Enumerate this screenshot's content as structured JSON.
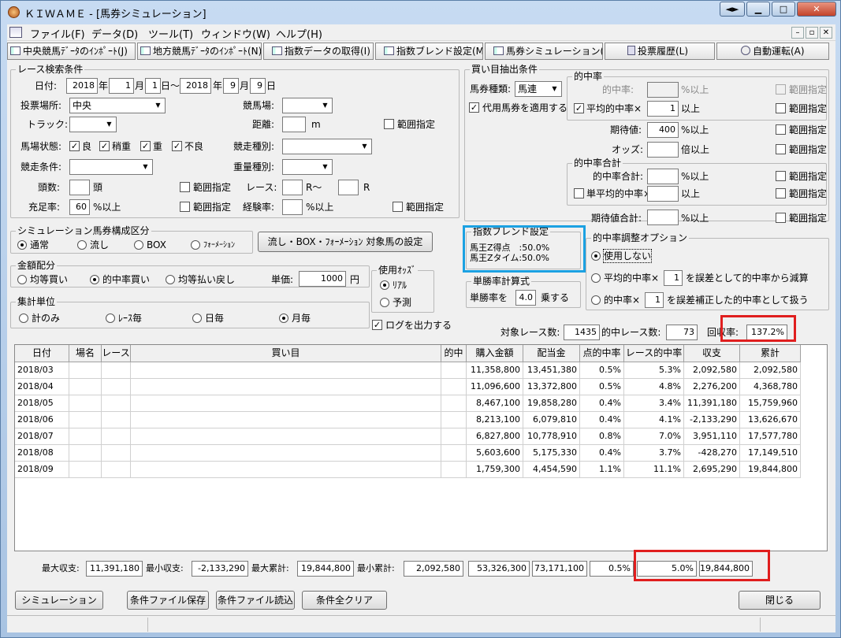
{
  "window": {
    "title": "ＫＩＷＡＭＥ - [馬券シミュレーション]"
  },
  "menu": [
    "ファイル(F)",
    "データ(D)",
    "ツール(T)",
    "ウィンドウ(W)",
    "ヘルプ(H)"
  ],
  "toolbar": [
    "中央競馬ﾃﾞｰﾀのｲﾝﾎﾟｰﾄ(J)",
    "地方競馬ﾃﾞｰﾀのｲﾝﾎﾟｰﾄ(N)",
    "指数データの取得(I)",
    "指数ブレンド設定(M)",
    "馬券シミュレーション(B)",
    "投票履歴(L)",
    "自動運転(A)"
  ],
  "race_search": {
    "label": "レース検索条件",
    "date_label": "日付:",
    "from_year": "2018",
    "from_month": "1",
    "from_day": "1",
    "to_year": "2018",
    "to_month": "9",
    "to_day": "9",
    "u_year": "年",
    "u_month": "月",
    "u_day_from": "日～",
    "u_day": "日",
    "venue_label": "投票場所:",
    "venue": "中央",
    "track_label": "競馬場:",
    "track2_label": "トラック:",
    "distance_label": "距離:",
    "distance_unit": "m",
    "range": "範囲指定",
    "condition_label": "馬場状態:",
    "conditions": [
      "良",
      "稍重",
      "重",
      "不良"
    ],
    "race_type_label": "競走種別:",
    "race_cond_label": "競走条件:",
    "weight_label": "重量種別:",
    "heads_label": "頭数:",
    "heads_unit": "頭",
    "race_label": "レース:",
    "r_from": "R～",
    "r_to": "R",
    "fill_label": "充足率:",
    "fill_value": "60",
    "fill_unit": "%以上",
    "exp_label": "経験率:",
    "exp_unit": "%以上"
  },
  "ticket_comp": {
    "label": "シミュレーション馬券構成区分",
    "options": [
      "通常",
      "流し",
      "BOX",
      "ﾌｫｰﾒｰｼｮﾝ"
    ],
    "selected": 0,
    "button": "流し・BOX・ﾌｫｰﾒｰｼｮﾝ 対象馬の設定"
  },
  "amount": {
    "label": "金額配分",
    "options": [
      "均等買い",
      "的中率買い",
      "均等払い戻し"
    ],
    "selected": 1,
    "unit_label": "単価:",
    "unit_value": "1000",
    "yen": "円"
  },
  "odds": {
    "label": "使用ｵｯｽﾞ",
    "options": [
      "ﾘｱﾙ",
      "予測"
    ],
    "selected": 0
  },
  "aggregate": {
    "label": "集計単位",
    "options": [
      "計のみ",
      "ﾚｰｽ毎",
      "日毎",
      "月毎"
    ],
    "selected": 3
  },
  "log_output": "ログを出力する",
  "extract": {
    "label": "買い目抽出条件",
    "type_label": "馬券種類:",
    "type_value": "馬連",
    "substitute": "代用馬券を適用する",
    "hit_group": "的中率",
    "hit_rate": "的中率:",
    "pct_over": "%以上",
    "avg_hit": "平均的中率×",
    "avg_value": "1",
    "over": "以上",
    "expect_label": "期待値:",
    "expect_value": "400",
    "odds_label": "オッズ:",
    "odds_unit": "倍以上",
    "sum_group": "的中率合計",
    "hit_sum": "的中率合計:",
    "single_avg": "単平均的中率×",
    "expect_sum": "期待値合計:",
    "range": "範囲指定"
  },
  "blend": {
    "label": "指数ブレンド設定",
    "line1": "馬王Z得点　:50.0%",
    "line2": "馬王Zタイム:50.0%"
  },
  "win_rate": {
    "label": "単勝率計算式",
    "prefix": "単勝率を",
    "value": "4.0",
    "suffix": "乗する"
  },
  "adjust": {
    "label": "的中率調整オプション",
    "opt0": "使用しない",
    "opt1a": "平均的中率×",
    "opt1b": "を誤差として的中率から減算",
    "opt2a": "的中率×",
    "opt2b": "を誤差補正した的中率として扱う",
    "v1": "1",
    "v2": "1",
    "selected": 0
  },
  "summary": {
    "target_label": "対象レース数:",
    "target": "1435",
    "hit_label": "的中レース数:",
    "hit": "73",
    "recovery_label": "回収率:",
    "recovery": "137.2%"
  },
  "table": {
    "headers": [
      "日付",
      "場名",
      "レース",
      "買い目",
      "的中",
      "購入金額",
      "配当金",
      "点的中率",
      "レース的中率",
      "収支",
      "累計"
    ],
    "rows": [
      [
        "2018/03",
        "",
        "",
        "",
        "",
        "11,358,800",
        "13,451,380",
        "0.5%",
        "5.3%",
        "2,092,580",
        "2,092,580"
      ],
      [
        "2018/04",
        "",
        "",
        "",
        "",
        "11,096,600",
        "13,372,800",
        "0.5%",
        "4.8%",
        "2,276,200",
        "4,368,780"
      ],
      [
        "2018/05",
        "",
        "",
        "",
        "",
        "8,467,100",
        "19,858,280",
        "0.4%",
        "3.4%",
        "11,391,180",
        "15,759,960"
      ],
      [
        "2018/06",
        "",
        "",
        "",
        "",
        "8,213,100",
        "6,079,810",
        "0.4%",
        "4.1%",
        "-2,133,290",
        "13,626,670"
      ],
      [
        "2018/07",
        "",
        "",
        "",
        "",
        "6,827,800",
        "10,778,910",
        "0.8%",
        "7.0%",
        "3,951,110",
        "17,577,780"
      ],
      [
        "2018/08",
        "",
        "",
        "",
        "",
        "5,603,600",
        "5,175,330",
        "0.4%",
        "3.7%",
        "-428,270",
        "17,149,510"
      ],
      [
        "2018/09",
        "",
        "",
        "",
        "",
        "1,759,300",
        "4,454,590",
        "1.1%",
        "11.1%",
        "2,695,290",
        "19,844,800"
      ]
    ]
  },
  "totals": {
    "max_income_label": "最大収支:",
    "max_income": "11,391,180",
    "min_income_label": "最小収支:",
    "min_income": "-2,133,290",
    "max_cum_label": "最大累計:",
    "max_cum": "19,844,800",
    "min_cum_label": "最小累計:",
    "min_cum": "2,092,580",
    "purchase": "53,326,300",
    "payout": "73,171,100",
    "point_rate": "0.5%",
    "race_rate": "5.0%",
    "total": "19,844,800"
  },
  "buttons": {
    "simulate": "シミュレーション",
    "save": "条件ファイル保存",
    "load": "条件ファイル読込",
    "clear": "条件全クリア",
    "close": "閉じる"
  }
}
